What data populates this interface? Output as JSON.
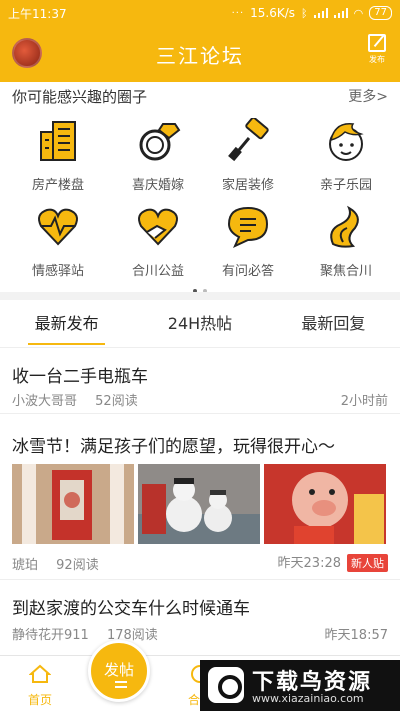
{
  "status_bar": {
    "time": "上午11:37",
    "speed": "15.6K/s",
    "battery": "77"
  },
  "header": {
    "title": "三江论坛",
    "post_label": "发布"
  },
  "circles": {
    "heading": "你可能感兴趣的圈子",
    "more": "更多>",
    "items": [
      {
        "label": "房产楼盘",
        "icon": "building-icon"
      },
      {
        "label": "喜庆婚嫁",
        "icon": "ring-icon"
      },
      {
        "label": "家居装修",
        "icon": "paint-roller-icon"
      },
      {
        "label": "亲子乐园",
        "icon": "baby-face-icon"
      },
      {
        "label": "情感驿站",
        "icon": "heart-pulse-icon"
      },
      {
        "label": "合川公益",
        "icon": "hand-heart-icon"
      },
      {
        "label": "有问必答",
        "icon": "chat-question-icon"
      },
      {
        "label": "聚焦合川",
        "icon": "wave-logo-icon"
      }
    ]
  },
  "tabs": [
    {
      "label": "最新发布"
    },
    {
      "label": "24H热帖"
    },
    {
      "label": "最新回复"
    }
  ],
  "posts": [
    {
      "title": "收一台二手电瓶车",
      "author": "小波大哥哥",
      "reads": "52阅读",
      "time": "2小时前"
    },
    {
      "title": "冰雪节！满足孩子们的愿望，玩得很开心～",
      "author": "琥珀",
      "reads": "92阅读",
      "time": "昨天23:28",
      "badge": "新人贴"
    },
    {
      "title": "到赵家渡的公交车什么时候通车",
      "author": "静待花开911",
      "reads": "178阅读",
      "time": "昨天18:57"
    }
  ],
  "bottom_nav": {
    "home": "首页",
    "fab": "发帖",
    "second": "合友"
  },
  "watermark": {
    "big": "下载鸟资源",
    "small": "www.xiazainiao.com"
  },
  "colors": {
    "brand": "#f6b80f",
    "badge": "#e8443a"
  }
}
